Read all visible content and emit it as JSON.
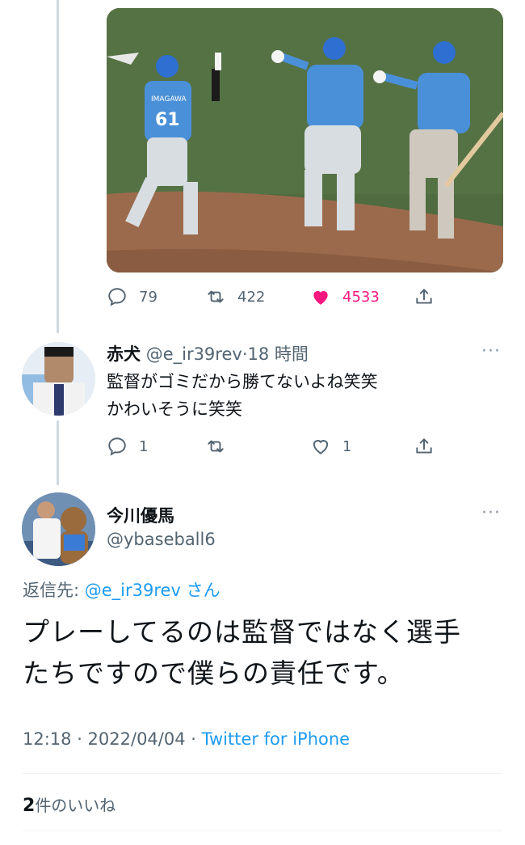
{
  "photo": {
    "alt_icon": "baseball-photo",
    "jersey_name": "IMAGAWA",
    "jersey_number": "61"
  },
  "parent_tweet_actions": {
    "reply_count": "79",
    "retweet_count": "422",
    "like_count": "4533"
  },
  "reply_tweet": {
    "display_name": "赤犬",
    "handle": "@e_ir39rev",
    "separator": "·",
    "time": "18 時間",
    "text_line1": "監督がゴミだから勝てないよね笑笑",
    "text_line2": "かわいそうに笑笑",
    "reply_count": "1",
    "retweet_count": "",
    "like_count": "1",
    "more": "···"
  },
  "main_tweet": {
    "display_name": "今川優馬",
    "handle": "@ybaseball6",
    "reply_to_label": "返信先: ",
    "reply_to_handle": "@e_ir39rev さん",
    "text_line1": "プレーしてるのは監督ではなく選手",
    "text_line2": "たちですので僕らの責任です。",
    "time": "12:18 · 2022/04/04 · ",
    "source": "Twitter for iPhone",
    "likes_count": "2",
    "likes_label": "件のいいね",
    "more": "···"
  },
  "colors": {
    "accent": "#1d9bf0",
    "like": "#f91880",
    "muted": "#536471",
    "jersey": "#4a90d9"
  }
}
